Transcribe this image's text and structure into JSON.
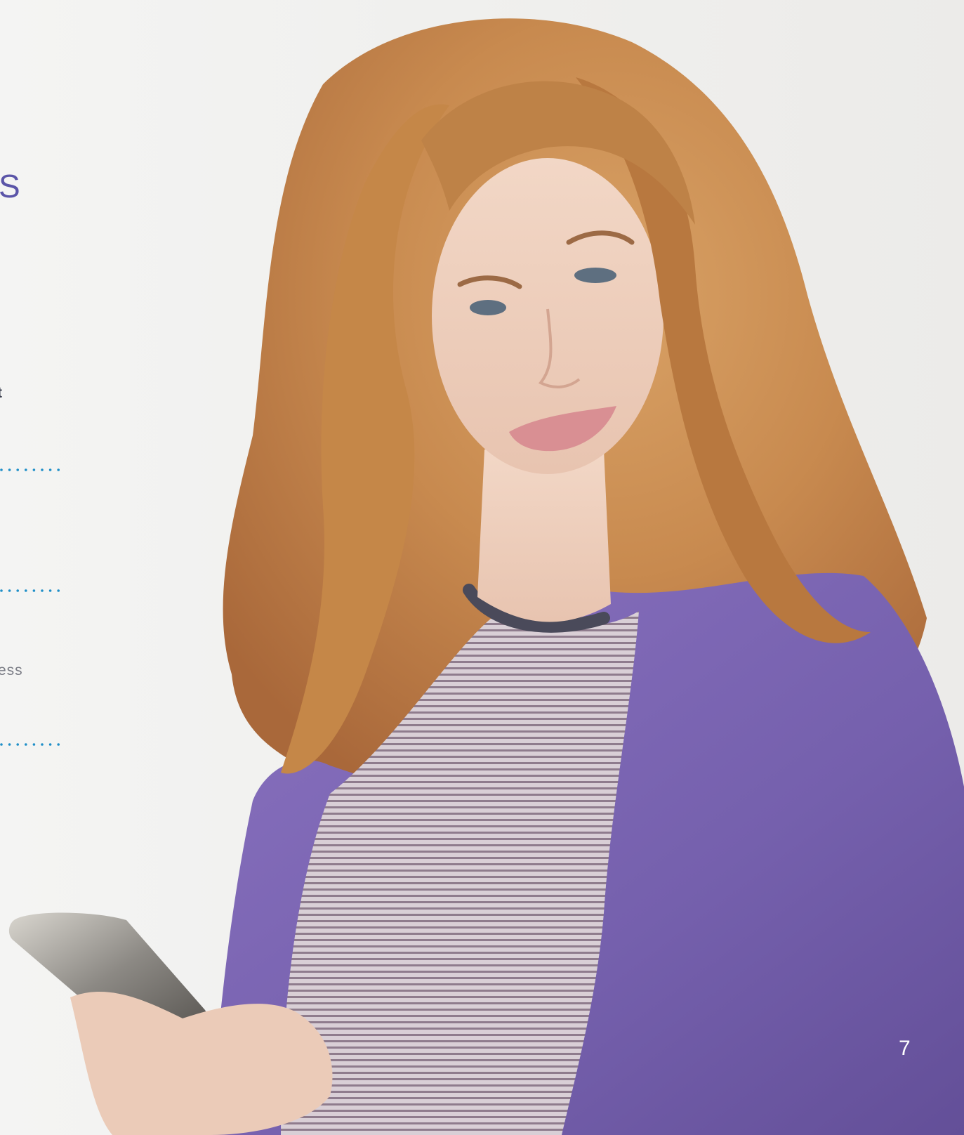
{
  "colors": {
    "heading": "#5b55a8",
    "bold_text": "#3b3f4f",
    "body_text": "#7a7c85",
    "dot_rule": "#1f8fc8",
    "page_number": "#ffffff",
    "jacket": "#7b62b0",
    "hair": "#c98d55"
  },
  "left_column": {
    "heading_fragment": "S",
    "bold_fragment": "t",
    "body_fragment": "ess"
  },
  "page_number": "7",
  "photo": {
    "icon": "woman-holding-smartphone-photo"
  }
}
